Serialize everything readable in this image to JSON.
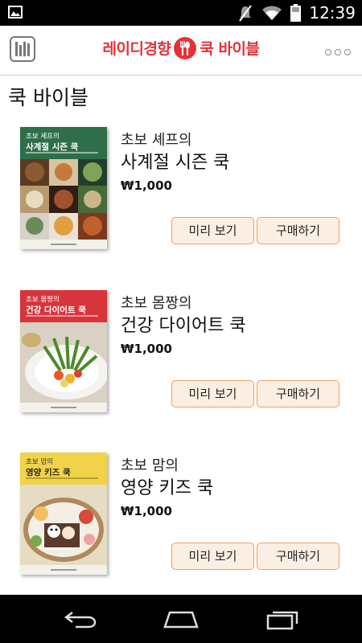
{
  "status_bar": {
    "time": "12:39"
  },
  "app_bar": {
    "brand_left": "레이디경향",
    "brand_right": "쿡 바이블",
    "brand_color": "#e53238"
  },
  "page": {
    "title": "쿡 바이블"
  },
  "books": [
    {
      "subtitle": "초보 셰프의",
      "title": "사계절 시즌 쿡",
      "price": "₩1,000",
      "preview_label": "미리 보기",
      "buy_label": "구매하기",
      "cover": {
        "line1": "초보 셰프의",
        "line2": "사계절 시즌 쿡",
        "color": "#2f6e4a"
      }
    },
    {
      "subtitle": "초보 몸짱의",
      "title": "건강 다이어트 쿡",
      "price": "₩1,000",
      "preview_label": "미리 보기",
      "buy_label": "구매하기",
      "cover": {
        "line1": "초보 몸짱의",
        "line2": "건강 다이어트 쿡",
        "color": "#d8343c"
      }
    },
    {
      "subtitle": "초보 맘의",
      "title": "영양 키즈 쿡",
      "price": "₩1,000",
      "preview_label": "미리 보기",
      "buy_label": "구매하기",
      "cover": {
        "line1": "초보 맘의",
        "line2": "영양 키즈 쿡",
        "color": "#f1d34a"
      }
    }
  ],
  "icons": {
    "statusbar": [
      "image-icon",
      "mute-icon",
      "wifi-icon",
      "battery-icon"
    ],
    "appbar": [
      "bookshelf-icon",
      "fork-spoon-icon",
      "overflow-menu-icon"
    ],
    "navbar": [
      "back-icon",
      "home-icon",
      "recent-apps-icon"
    ]
  }
}
